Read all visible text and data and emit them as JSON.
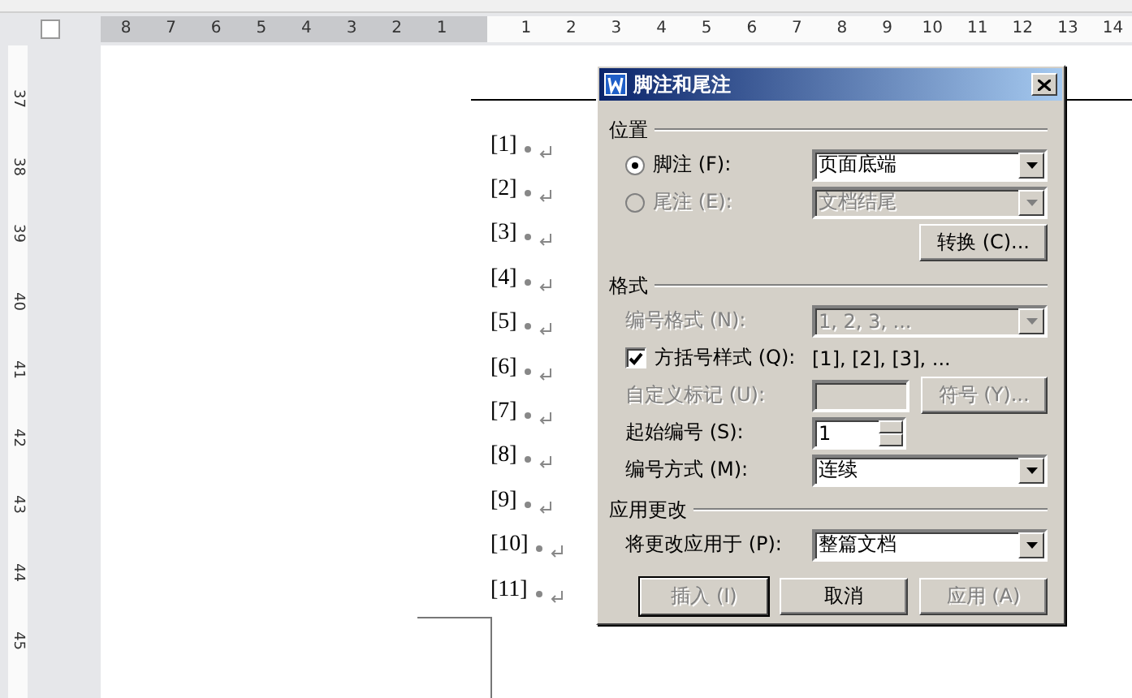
{
  "ruler": {
    "left_numbers": [
      "8",
      "7",
      "6",
      "5",
      "4",
      "3",
      "2",
      "1"
    ],
    "right_numbers": [
      "1",
      "2",
      "3",
      "4",
      "5",
      "6",
      "7",
      "8",
      "9",
      "10",
      "11",
      "12",
      "13",
      "14"
    ],
    "vertical_numbers": [
      "37",
      "38",
      "39",
      "40",
      "41",
      "42",
      "43",
      "44",
      "45"
    ]
  },
  "footnotes": [
    {
      "mark": "[1]"
    },
    {
      "mark": "[2]"
    },
    {
      "mark": "[3]"
    },
    {
      "mark": "[4]"
    },
    {
      "mark": "[5]"
    },
    {
      "mark": "[6]"
    },
    {
      "mark": "[7]"
    },
    {
      "mark": "[8]"
    },
    {
      "mark": "[9]"
    },
    {
      "mark": "[10]"
    },
    {
      "mark": "[11]"
    }
  ],
  "dialog": {
    "title": "脚注和尾注",
    "sections": [
      {
        "heading": "位置",
        "rows": [
          {
            "kind": "radio_select",
            "label": "脚注 (F):",
            "selected": true,
            "disabled": false,
            "value": "页面底端"
          },
          {
            "kind": "radio_select",
            "label": "尾注 (E):",
            "selected": false,
            "disabled": true,
            "value": "文档结尾"
          },
          {
            "kind": "button",
            "label": "转换 (C)...",
            "disabled": false
          }
        ]
      },
      {
        "heading": "格式",
        "rows": [
          {
            "kind": "select",
            "label": "编号格式 (N):",
            "disabled": true,
            "value": "1, 2, 3, ..."
          },
          {
            "kind": "checkbox",
            "label": "方括号样式 (Q):",
            "checked": true,
            "value": "[1], [2], [3], ..."
          },
          {
            "kind": "text_button",
            "label": "自定义标记 (U):",
            "disabled": true,
            "button": "符号 (Y)..."
          },
          {
            "kind": "spinner",
            "label": "起始编号 (S):",
            "disabled": false,
            "value": "1"
          },
          {
            "kind": "select",
            "label": "编号方式 (M):",
            "disabled": false,
            "value": "连续"
          }
        ]
      },
      {
        "heading": "应用更改",
        "rows": [
          {
            "kind": "select",
            "label": "将更改应用于 (P):",
            "disabled": false,
            "value": "整篇文档"
          }
        ]
      }
    ],
    "buttons": [
      {
        "label": "插入 (I)",
        "disabled": true,
        "default": true
      },
      {
        "label": "取消",
        "disabled": false,
        "default": false
      },
      {
        "label": "应用 (A)",
        "disabled": true,
        "default": false
      }
    ]
  }
}
